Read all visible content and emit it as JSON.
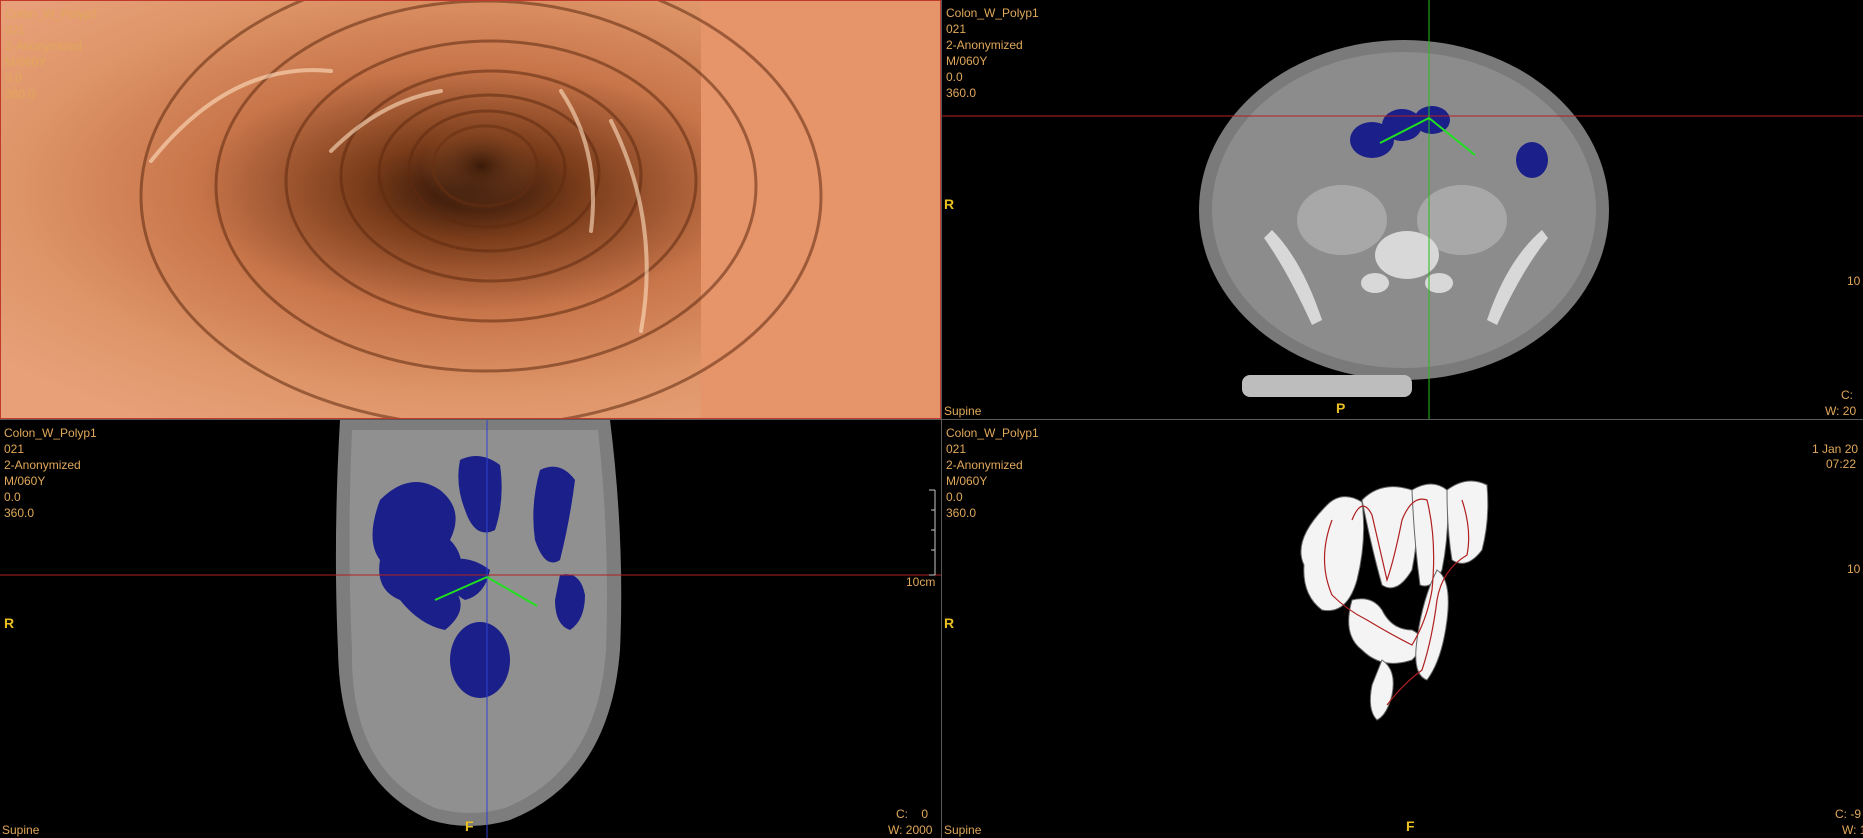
{
  "study": {
    "name": "Colon_W_Polyp1",
    "id": "021",
    "patient": "2-Anonymized",
    "sex_age": "M/060Y",
    "value_a": "0.0",
    "value_b": "360.0"
  },
  "axial": {
    "orient_left": "R",
    "orient_bottom": "P",
    "position": "Supine",
    "scale_label": "10",
    "center_label": "C:",
    "width_label": "W: 20"
  },
  "coronal": {
    "orient_left": "R",
    "orient_bottom": "F",
    "position": "Supine",
    "scale_label": "10cm",
    "center_label": "C:    0",
    "width_label": "W: 2000"
  },
  "model": {
    "orient_left": "R",
    "orient_bottom": "F",
    "position": "Supine",
    "date_label": "1 Jan 20",
    "time_label": "07:22",
    "scale_label": "10",
    "center_label": "C: -9",
    "width_label": "W: 1"
  },
  "colors": {
    "endo_tissue": "#d9875a",
    "crosshair_h": "#b02020",
    "crosshair_v_axial": "#20c020",
    "crosshair_v_coronal": "#3040d0",
    "colon_fill": "#1a1f8a",
    "orient_text": "#e8c020",
    "info_text": "#e0a85a"
  }
}
